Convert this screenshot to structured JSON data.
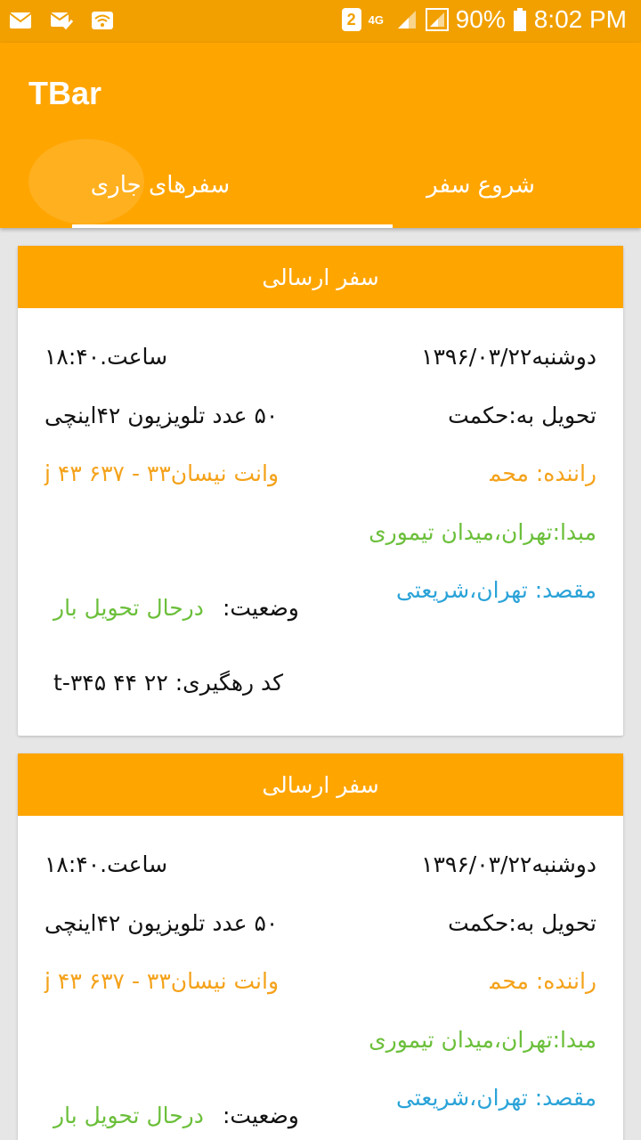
{
  "status_bar": {
    "notification_badge": "2",
    "network_type": "4G",
    "battery_percent": "90%",
    "time": "8:02 PM",
    "icons": [
      "mail-icon",
      "mail-check-icon",
      "wifi-icon",
      "badge-icon",
      "network-4g-icon",
      "signal-icon",
      "signal-box-icon",
      "battery-icon"
    ]
  },
  "app": {
    "title": "TBar"
  },
  "tabs": [
    {
      "label": "سفرهای جاری",
      "selected": true
    },
    {
      "label": "شروع سفر",
      "selected": false
    }
  ],
  "trips": [
    {
      "header": "سفر ارسالی",
      "date": "دوشنبه۱۳۹۶/۰۳/۲۲",
      "time": "ساعت.۱۸:۴۰",
      "deliver_to": "تحویل به:حکمت",
      "cargo": "۵۰ عدد تلویزیون ۴۲اینچی",
      "driver": "راننده: محمد",
      "vehicle": "وانت نیسان۳۳ - ۶۳۷ j ۴۳",
      "origin": "مبدا:تهران،میدان تیموری",
      "destination": "مقصد: تهران،شریعتی",
      "status_label": "وضعیت:",
      "status_value": "درحال تحویل بار",
      "tracking": "کد رهگیری: ۲۲ ۴۴ ۳۴۵-t"
    },
    {
      "header": "سفر ارسالی",
      "date": "دوشنبه۱۳۹۶/۰۳/۲۲",
      "time": "ساعت.۱۸:۴۰",
      "deliver_to": "تحویل به:حکمت",
      "cargo": "۵۰ عدد تلویزیون ۴۲اینچی",
      "driver": "راننده: محمد",
      "vehicle": "وانت نیسان۳۳ - ۶۳۷ j ۴۳",
      "origin": "مبدا:تهران،میدان تیموری",
      "destination": "مقصد: تهران،شریعتی",
      "status_label": "وضعیت:",
      "status_value": "درحال تحویل بار"
    }
  ]
}
